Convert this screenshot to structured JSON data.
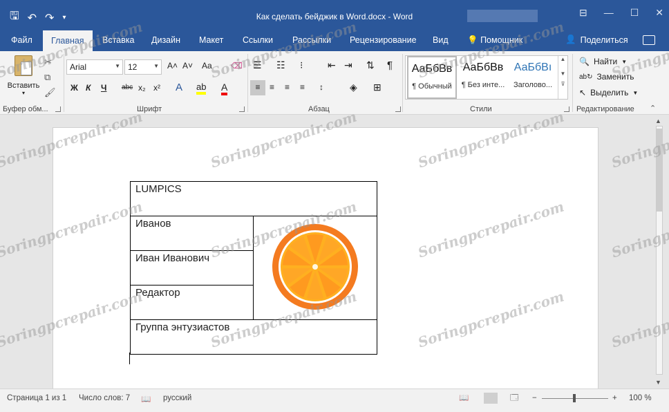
{
  "window": {
    "title": "Как сделать бейджик в Word.docx  -  Word",
    "controls": [
      "⊟",
      "—",
      "☐",
      "✕"
    ]
  },
  "qat": {
    "save": "🖫",
    "undo": "↶",
    "redo": "↷",
    "more": "▾"
  },
  "tabs": [
    {
      "label": "Файл"
    },
    {
      "label": "Главная"
    },
    {
      "label": "Вставка"
    },
    {
      "label": "Дизайн"
    },
    {
      "label": "Макет"
    },
    {
      "label": "Ссылки"
    },
    {
      "label": "Рассылки"
    },
    {
      "label": "Рецензирование"
    },
    {
      "label": "Вид"
    },
    {
      "label": "Помощник"
    }
  ],
  "share_label": "Поделиться",
  "clipboard": {
    "paste_label": "Вставить",
    "group": "Буфер обм..."
  },
  "font": {
    "name": "Arial",
    "size": "12",
    "group": "Шрифт",
    "bold": "Ж",
    "italic": "К",
    "underline": "Ч",
    "strike": "abc",
    "sub": "x₂",
    "sup": "x²",
    "grow": "A˄",
    "shrink": "A˅",
    "case": "Aa"
  },
  "paragraph": {
    "group": "Абзац",
    "pilcrow": "¶"
  },
  "styles": {
    "group": "Стили",
    "items": [
      {
        "sample": "АаБбВв",
        "name": "¶ Обычный"
      },
      {
        "sample": "АаБбВв",
        "name": "¶ Без инте..."
      },
      {
        "sample": "АаБбВı",
        "name": "Заголово..."
      }
    ]
  },
  "editing": {
    "group": "Редактирование",
    "find": "Найти",
    "replace": "Заменить",
    "select": "Выделить"
  },
  "badge": {
    "company": "LUMPICS",
    "surname": "Иванов",
    "name": "Иван Иванович",
    "position": "Редактор",
    "group": "Группа энтузиастов"
  },
  "statusbar": {
    "page": "Страница 1 из 1",
    "words": "Число слов: 7",
    "language": "русский",
    "zoom": "100 %",
    "minus": "−",
    "plus": "+"
  },
  "watermark_text": "Soringpcrepair.com",
  "colors": {
    "accent": "#2b579a",
    "orange_outer": "#f47b20",
    "orange_inner": "#ffb020"
  }
}
